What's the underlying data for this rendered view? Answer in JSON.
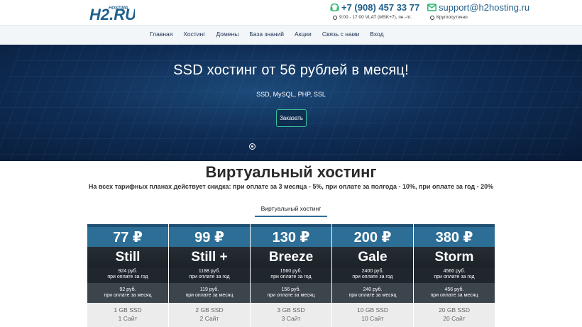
{
  "header": {
    "logo_text": "H2.RU",
    "logo_hosting": "HOSTING",
    "phone": "+7 (908) 457 33 77",
    "hours": "9:00 - 17:00 VLAT (MSK+7), пн.-пт.",
    "email": "support@h2hosting.ru",
    "email_hours": "Круглосуточно",
    "accent_color": "#1f5f8b",
    "icon_color": "#2bb673"
  },
  "nav": {
    "items": [
      "Главная",
      "Хостинг",
      "Домены",
      "База знаний",
      "Акции",
      "Связь с нами",
      "Вход"
    ]
  },
  "hero": {
    "title": "SSD хостинг от 56 рублей в месяц!",
    "tags": "SSD, MySQL, PHP, SSL",
    "button": "Заказать"
  },
  "section": {
    "title": "Виртуальный хостинг",
    "discount": "На всех тарифных планах действует скидка: при оплате за 3 месяца - 5%, при оплате за полгода - 10%, при оплате за год - 20%",
    "tab": "Виртуальный хостинг"
  },
  "plans": [
    {
      "price": "77 ₽",
      "name": "Still",
      "year_price": "924 руб.",
      "year_label": "при оплате за год",
      "month_price": "92 руб.",
      "month_label": "при оплате за месяц",
      "disk": "1 GB SSD",
      "sites": "1 Сайт"
    },
    {
      "price": "99 ₽",
      "name": "Still +",
      "year_price": "1188 руб.",
      "year_label": "при оплате за год",
      "month_price": "119 руб.",
      "month_label": "при оплате за месяц",
      "disk": "2 GB SSD",
      "sites": "2 Сайт"
    },
    {
      "price": "130 ₽",
      "name": "Breeze",
      "year_price": "1560 руб.",
      "year_label": "при оплате за год",
      "month_price": "156 руб.",
      "month_label": "при оплате за месяц",
      "disk": "3 GB  SSD",
      "sites": "3 Сайт"
    },
    {
      "price": "200 ₽",
      "name": "Gale",
      "year_price": "2400 руб.",
      "year_label": "при оплате за год",
      "month_price": "240 руб.",
      "month_label": "при оплате за месяц",
      "disk": "10 GB  SSD",
      "sites": "10 Сайт"
    },
    {
      "price": "380 ₽",
      "name": "Storm",
      "year_price": "4560 руб.",
      "year_label": "при оплате за год",
      "month_price": "456 руб.",
      "month_label": "при оплате за месяц",
      "disk": "20 GB  SSD",
      "sites": "20 Сайт"
    }
  ]
}
